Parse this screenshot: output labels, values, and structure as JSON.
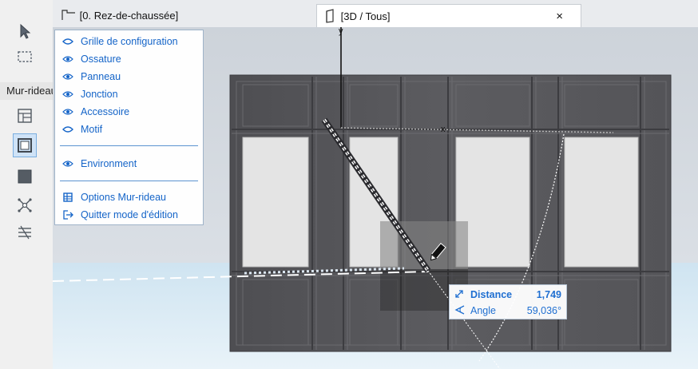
{
  "toolbox": {
    "group_label": "Mur-rideau",
    "tools": [
      {
        "name": "arrow-tool"
      },
      {
        "name": "marquee-tool"
      },
      {
        "name": "curtain-wall-scheme-tool"
      },
      {
        "name": "frame-tool"
      },
      {
        "name": "panel-tool"
      },
      {
        "name": "junction-tool"
      },
      {
        "name": "accessory-tool"
      }
    ]
  },
  "tabs": [
    {
      "label": "[0. Rez-de-chaussée]",
      "icon": "floor-plan-icon",
      "active": false
    },
    {
      "label": "[3D / Tous]",
      "icon": "3d-window-icon",
      "active": true,
      "close": "×"
    }
  ],
  "panel": {
    "items": [
      {
        "label": "Grille de configuration",
        "icon": "eye-outline-icon"
      },
      {
        "label": "Ossature",
        "icon": "eye-icon"
      },
      {
        "label": "Panneau",
        "icon": "eye-icon"
      },
      {
        "label": "Jonction",
        "icon": "eye-icon"
      },
      {
        "label": "Accessoire",
        "icon": "eye-icon"
      },
      {
        "label": "Motif",
        "icon": "eye-outline-icon"
      },
      {
        "label": "Environment",
        "icon": "eye-icon"
      },
      {
        "label": "Options Mur-rideau",
        "icon": "grid-options-icon"
      },
      {
        "label": "Quitter mode d'édition",
        "icon": "exit-icon"
      }
    ]
  },
  "tracker": {
    "distance_label": "Distance",
    "distance_value": "1,749",
    "angle_label": "Angle",
    "angle_value": "59,036°"
  },
  "axes": {
    "x": "x",
    "y": "y"
  },
  "colors": {
    "accent": "#1f6fd1",
    "wall": "#5a5a5e",
    "panel_glass": "#e4e4e4"
  }
}
